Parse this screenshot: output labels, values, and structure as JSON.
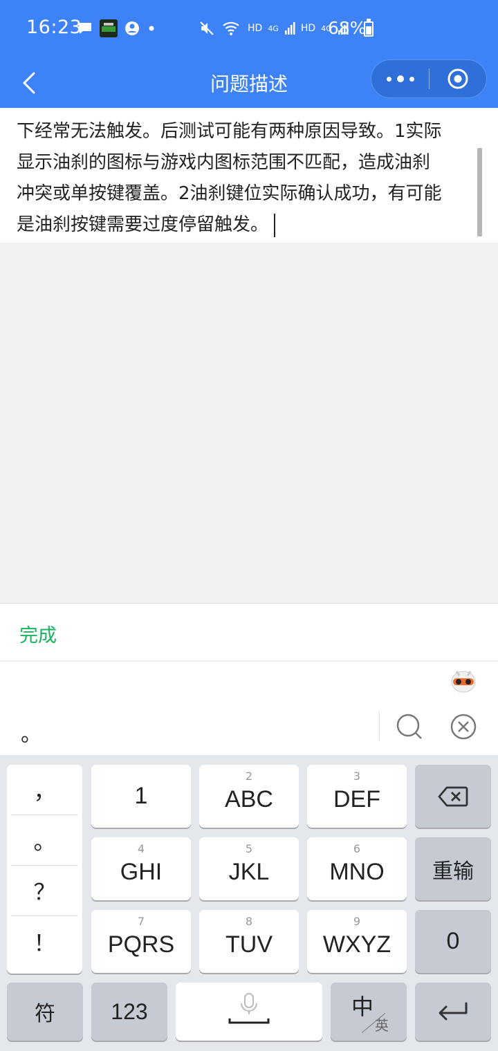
{
  "status_bar": {
    "time": "16:23",
    "battery": "68%",
    "signal_labels": [
      "HD",
      "4G",
      "HD",
      "4G"
    ]
  },
  "nav": {
    "title": "问题描述"
  },
  "editor": {
    "lines": [
      "下经常无法触发。后测试可能有两种原因导致。1实际",
      "显示油刹的图标与游戏内图标范围不匹配，造成油刹",
      "冲突或单按键覆盖。2油刹键位实际确认成功，有可能",
      "是油刹按键需要过度停留触发。"
    ]
  },
  "done_bar": {
    "done_label": "完成"
  },
  "ime": {
    "candidate": "。",
    "punctuation": [
      "，",
      "。",
      "？",
      "！"
    ],
    "keys": {
      "k1": {
        "main": "1"
      },
      "k2": {
        "sub": "2",
        "main": "ABC"
      },
      "k3": {
        "sub": "3",
        "main": "DEF"
      },
      "k4": {
        "sub": "4",
        "main": "GHI"
      },
      "k5": {
        "sub": "5",
        "main": "JKL"
      },
      "k6": {
        "sub": "6",
        "main": "MNO"
      },
      "k7": {
        "sub": "7",
        "main": "PQRS"
      },
      "k8": {
        "sub": "8",
        "main": "TUV"
      },
      "k9": {
        "sub": "9",
        "main": "WXYZ"
      },
      "retype": "重输",
      "zero": "0",
      "symbols": "符",
      "num123": "123",
      "lang_main": "中",
      "lang_alt": "英"
    }
  },
  "colors": {
    "header": "#3d82f6",
    "done": "#17b35d",
    "keyboard_bg": "#e4e7eb"
  }
}
